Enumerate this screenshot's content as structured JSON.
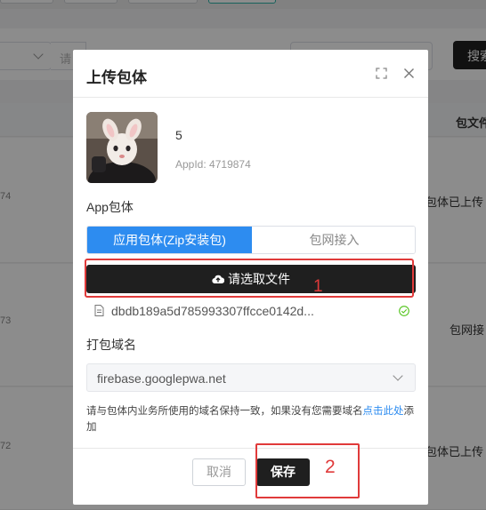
{
  "background": {
    "filter": {
      "input_placeholder": "请",
      "search_button": "搜索"
    },
    "table": {
      "column_header": "包文件",
      "rows": [
        {
          "num": "74",
          "status": "包体已上传"
        },
        {
          "num": "73",
          "status": "包网接"
        },
        {
          "num": "72",
          "status": "包体已上传"
        }
      ]
    }
  },
  "dialog": {
    "title": "上传包体",
    "app": {
      "name": "5",
      "id_label": "AppId:",
      "id_value": "4719874"
    },
    "package_label": "App包体",
    "tabs": [
      {
        "label": "应用包体(Zip安装包)",
        "active": true
      },
      {
        "label": "包网接入",
        "active": false
      }
    ],
    "upload_button": "请选取文件",
    "file": {
      "name": "dbdb189a5d785993307ffcce0142d..."
    },
    "domain_label": "打包域名",
    "domain_value": "firebase.googlepwa.net",
    "hint_text": "请与包体内业务所使用的域名保持一致，如果没有您需要域名",
    "hint_link": "点击此处",
    "hint_suffix": "添加",
    "cancel_button": "取消",
    "save_button": "保存"
  },
  "annotations": {
    "step1": "1",
    "step2": "2",
    "color": "#e03a3a"
  },
  "colors": {
    "accent": "#2d8cf0",
    "dark_button": "#1f1f1f",
    "success": "#52c41a"
  }
}
